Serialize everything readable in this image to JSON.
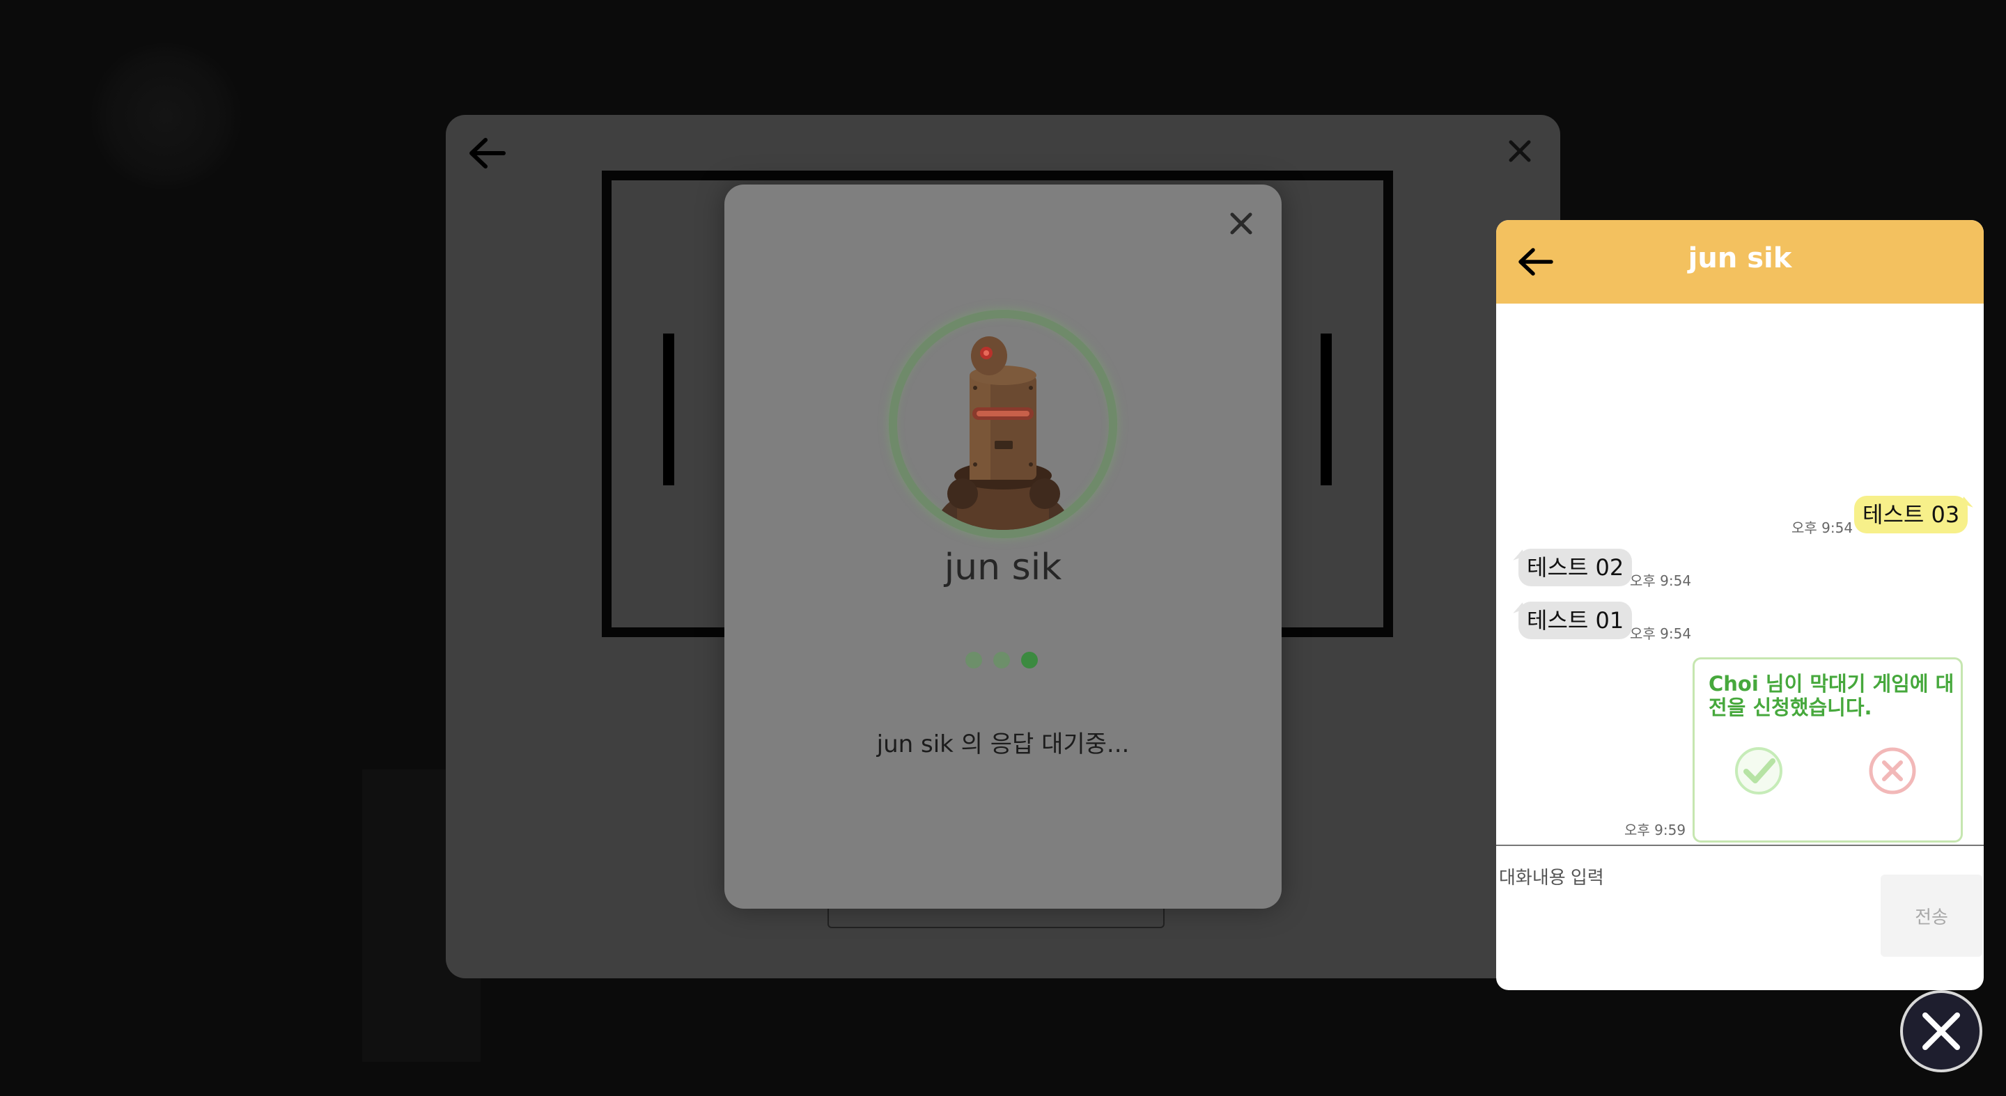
{
  "waiting_modal": {
    "player_name": "jun sik",
    "status_text": "jun sik 의 응답 대기중..."
  },
  "chat": {
    "title": "jun sik",
    "messages": [
      {
        "sender": "me",
        "text": "테스트 03",
        "time": "오후 9:54"
      },
      {
        "sender": "other",
        "text": "테스트 02",
        "time": "오후 9:54"
      },
      {
        "sender": "other",
        "text": "테스트 01",
        "time": "오후 9:54"
      }
    ],
    "invite": {
      "text": "Choi 님이 막대기 게임에 대전을 신청했습니다.",
      "time": "오후 9:59"
    },
    "input_placeholder": "대화내용 입력",
    "send_label": "전송"
  },
  "colors": {
    "chat_header": "#f3c15f",
    "my_bubble": "#f7f08a",
    "other_bubble": "#e4e4e4",
    "invite_text": "#46a83c",
    "accept_icon": "#c6ecb8",
    "decline_icon": "#f2b8b8"
  },
  "icons": {
    "game_back": "arrow-left-icon",
    "game_close": "close-icon",
    "modal_close": "close-icon",
    "chat_back": "arrow-left-icon",
    "accept": "check-circle-icon",
    "decline": "x-circle-icon",
    "overlay_close": "close-icon"
  }
}
